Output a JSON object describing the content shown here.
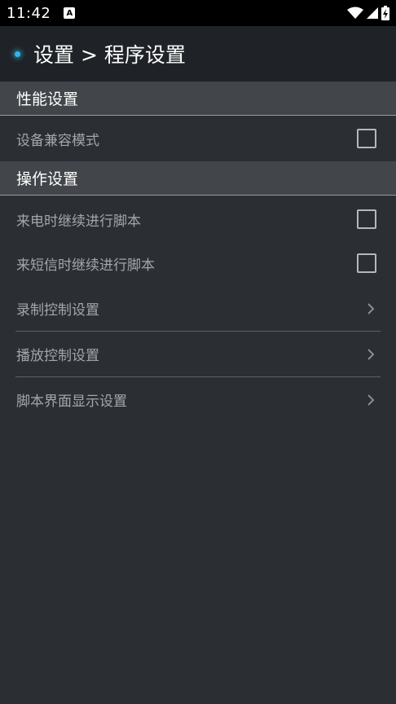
{
  "status_bar": {
    "time": "11:42",
    "notification_icon": "A"
  },
  "app_bar": {
    "title": "设置 > 程序设置"
  },
  "sections": [
    {
      "header": "性能设置",
      "items": [
        {
          "label": "设备兼容模式",
          "type": "checkbox",
          "checked": false
        }
      ]
    },
    {
      "header": "操作设置",
      "items": [
        {
          "label": "来电时继续进行脚本",
          "type": "checkbox",
          "checked": false
        },
        {
          "label": "来短信时继续进行脚本",
          "type": "checkbox",
          "checked": false
        },
        {
          "label": "录制控制设置",
          "type": "nav"
        },
        {
          "label": "播放控制设置",
          "type": "nav"
        },
        {
          "label": "脚本界面显示设置",
          "type": "nav"
        }
      ]
    }
  ],
  "colors": {
    "accent": "#33b5e5",
    "background": "#2b2f33",
    "section": "#42464a"
  }
}
